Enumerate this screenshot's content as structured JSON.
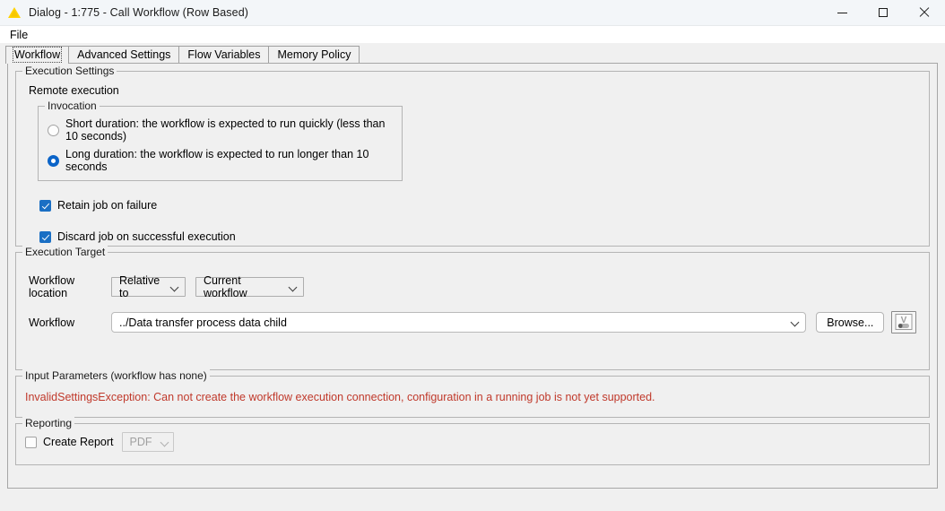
{
  "window": {
    "title": "Dialog - 1:775 - Call Workflow (Row Based)",
    "app_icon": "knime-triangle-icon",
    "controls": {
      "minimize": "minimize-icon",
      "maximize": "maximize-icon",
      "close": "close-icon"
    }
  },
  "menubar": {
    "items": [
      {
        "label": "File"
      }
    ]
  },
  "tabs": [
    {
      "label": "Workflow",
      "selected": true
    },
    {
      "label": "Advanced Settings",
      "selected": false
    },
    {
      "label": "Flow Variables",
      "selected": false
    },
    {
      "label": "Memory Policy",
      "selected": false
    }
  ],
  "execution_settings": {
    "title": "Execution Settings",
    "remote_execution_label": "Remote execution",
    "invocation": {
      "title": "Invocation",
      "options": [
        {
          "label": "Short duration: the workflow is expected to run quickly (less than 10 seconds)",
          "selected": false
        },
        {
          "label": "Long duration: the workflow is expected to run longer than 10 seconds",
          "selected": true
        }
      ]
    },
    "checkboxes": [
      {
        "label": "Retain job on failure",
        "checked": true
      },
      {
        "label": "Discard job on successful execution",
        "checked": true
      }
    ]
  },
  "execution_target": {
    "title": "Execution Target",
    "workflow_location_label": "Workflow location",
    "location_type": "Relative to",
    "location_base": "Current workflow",
    "workflow_label": "Workflow",
    "workflow_value": "../Data transfer process data child",
    "browse_label": "Browse...",
    "flow_variable_button": "flow-variable-icon"
  },
  "input_parameters": {
    "title": "Input Parameters (workflow has none)",
    "error_message": "InvalidSettingsException: Can not create the workflow execution connection, configuration in a running job is not yet supported.",
    "error_color": "#c0392b"
  },
  "reporting": {
    "title": "Reporting",
    "create_report_label": "Create Report",
    "create_report_checked": false,
    "format": "PDF",
    "format_disabled": true
  },
  "colors": {
    "accent": "#0b64c8",
    "checkbox": "#1a6fc4",
    "error": "#c0392b",
    "titlebar": "#f3f6f9",
    "panel": "#f0f0f0"
  }
}
